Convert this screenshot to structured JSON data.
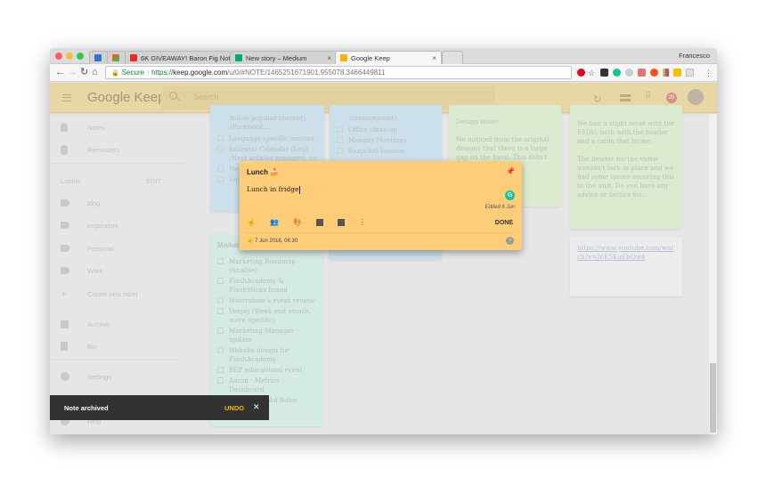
{
  "browser": {
    "user": "Francesco",
    "tabs": [
      {
        "label": "",
        "favicon": "calendar-icon",
        "color": "#3b6fd8"
      },
      {
        "label": "",
        "favicon": "office-icon",
        "color": "#e8612c"
      },
      {
        "label": "6K GIVEAWAY! Baron Fig Note",
        "favicon": "youtube-icon",
        "color": "#e52d27"
      },
      {
        "label": "New story – Medium",
        "favicon": "medium-icon",
        "color": "#00ab6c"
      },
      {
        "label": "Google Keep",
        "favicon": "keep-icon",
        "color": "#f6b400",
        "active": true
      }
    ],
    "secure_label": "Secure",
    "url_scheme": "https://",
    "url_host": "keep.google.com",
    "url_path": "/u/0/#NOTE/1465251671901.955078.3466449811"
  },
  "keep": {
    "logo": "Google Keep",
    "search_placeholder": "Search",
    "notification_count": "20"
  },
  "sidebar": {
    "top_items": [
      {
        "label": "Notes",
        "icon": "lightbulb-icon"
      },
      {
        "label": "Reminders",
        "icon": "reminder-hand-icon"
      }
    ],
    "labels_heading": "Labels",
    "edit_label": "EDIT",
    "labels": [
      {
        "label": "blog"
      },
      {
        "label": "Inspiration"
      },
      {
        "label": "Personal"
      },
      {
        "label": "Work"
      }
    ],
    "create_label": "Create new label",
    "archive": "Archive",
    "bin": "Bin",
    "settings": "Settings",
    "help": "Help"
  },
  "notes": {
    "note1": {
      "partial_top": "follow popular content) (Facebook...",
      "items": [
        "Language specific content",
        "Editorial Calendar (Leti) (Next articles prepared, co",
        "Ne fut",
        "Eu"
      ]
    },
    "note2": {
      "partial_top": "(management)",
      "items": [
        "Office clean-up",
        "Monday Meetings",
        "Snapchat lessons"
      ]
    },
    "note3": {
      "title": "Design issue:",
      "body": "We noticed from the original designs that there is a large gap on the band. This didn't ... of the"
    },
    "note4": {
      "body1": "We had a slight issue with the FSDU, both with the header and a cable that broke.",
      "body2": "The header for the video wouldn't lock in place and we had some issues securing this to the unit. Do you have any advice or tactics for..."
    },
    "note5": {
      "link": "https://www.youtube.com/watch?v=J6E5KuEhQw4"
    },
    "note6": {
      "title": "Market",
      "items": [
        "Marketing Roadmap (finalise)",
        "FlashAcademy & FlashSticks brand",
        "Waterstone's event review",
        "Veejay (Week end emails, more specific)",
        "Marketing Manager update",
        "Website design for FlashAcademy",
        "BEP educational event",
        "Aaron - Metrics Dashboard",
        "& Ad Roles"
      ]
    }
  },
  "editor": {
    "title": "Lunch",
    "title_emoji": "🍰",
    "body": "Lunch in fridge",
    "edited": "Edited 6 Jun",
    "done_label": "DONE",
    "reminder": "7 Jun 2016, 06:30",
    "tools": [
      "remind-me-icon",
      "collaborator-icon",
      "palette-icon",
      "image-icon",
      "archive-icon",
      "more-icon"
    ],
    "color": "#fecd7a"
  },
  "snackbar": {
    "message": "Note archived",
    "undo": "UNDO",
    "close": "✕"
  }
}
